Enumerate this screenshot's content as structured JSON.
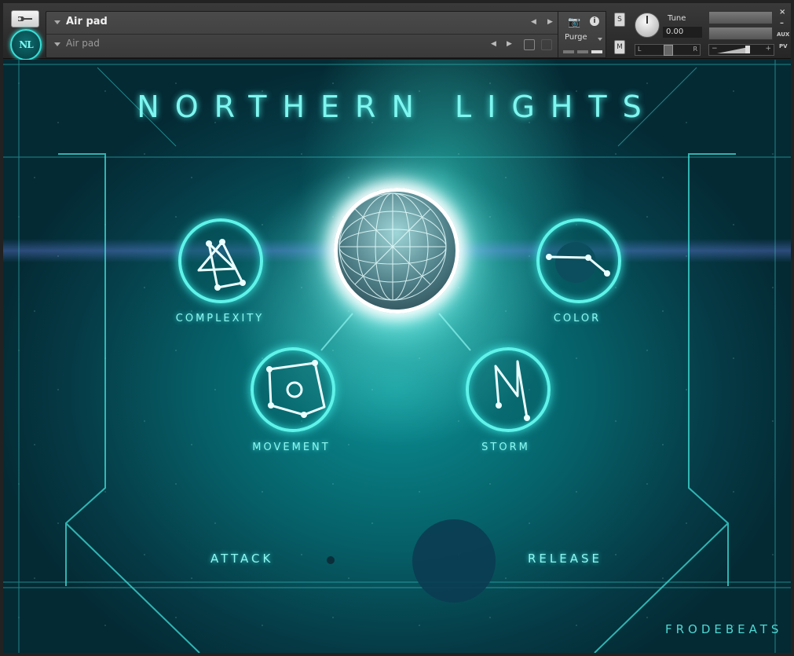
{
  "header": {
    "instrument_name": "Air pad",
    "preset_name": "Air pad",
    "logo_text": "NL",
    "purge_label": "Purge",
    "solo_label": "S",
    "mute_label": "M",
    "tune_label": "Tune",
    "tune_value": "0.00",
    "pan_left": "L",
    "pan_right": "R",
    "close_glyph": "×",
    "minimize_glyph": "–",
    "aux_label": "AUX",
    "pv_label": "PV",
    "vol_minus": "−",
    "vol_plus": "+"
  },
  "instrument": {
    "title": "NORTHERN LIGHTS",
    "knobs": {
      "complexity": "COMPLEXITY",
      "color": "COLOR",
      "movement": "MOVEMENT",
      "storm": "STORM"
    },
    "attack_label": "ATTACK",
    "release_label": "RELEASE",
    "brand": "FRODEBEATS"
  },
  "colors": {
    "accent": "#5ff3ea",
    "panel_dark": "#053a45"
  }
}
